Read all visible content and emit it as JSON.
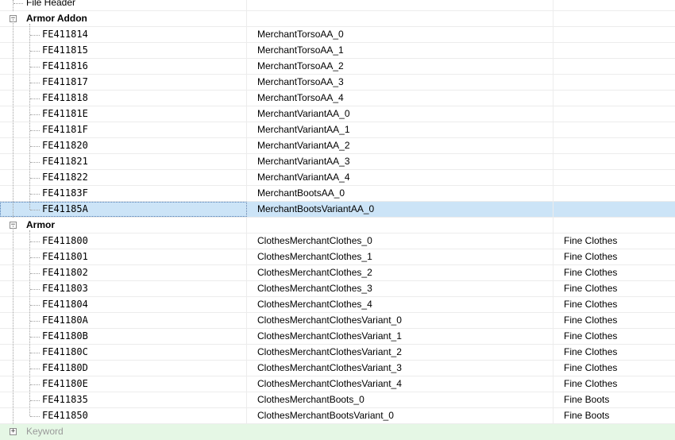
{
  "top": {
    "label": "File Header"
  },
  "groups": [
    {
      "label": "Armor Addon",
      "rows": [
        {
          "formid": "FE411814",
          "edid": "MerchantTorsoAA_0",
          "name": ""
        },
        {
          "formid": "FE411815",
          "edid": "MerchantTorsoAA_1",
          "name": ""
        },
        {
          "formid": "FE411816",
          "edid": "MerchantTorsoAA_2",
          "name": ""
        },
        {
          "formid": "FE411817",
          "edid": "MerchantTorsoAA_3",
          "name": ""
        },
        {
          "formid": "FE411818",
          "edid": "MerchantTorsoAA_4",
          "name": ""
        },
        {
          "formid": "FE41181E",
          "edid": "MerchantVariantAA_0",
          "name": ""
        },
        {
          "formid": "FE41181F",
          "edid": "MerchantVariantAA_1",
          "name": ""
        },
        {
          "formid": "FE411820",
          "edid": "MerchantVariantAA_2",
          "name": ""
        },
        {
          "formid": "FE411821",
          "edid": "MerchantVariantAA_3",
          "name": ""
        },
        {
          "formid": "FE411822",
          "edid": "MerchantVariantAA_4",
          "name": ""
        },
        {
          "formid": "FE41183F",
          "edid": "MerchantBootsAA_0",
          "name": ""
        },
        {
          "formid": "FE41185A",
          "edid": "MerchantBootsVariantAA_0",
          "name": "",
          "selected": true
        }
      ]
    },
    {
      "label": "Armor",
      "rows": [
        {
          "formid": "FE411800",
          "edid": "ClothesMerchantClothes_0",
          "name": "Fine Clothes"
        },
        {
          "formid": "FE411801",
          "edid": "ClothesMerchantClothes_1",
          "name": "Fine Clothes"
        },
        {
          "formid": "FE411802",
          "edid": "ClothesMerchantClothes_2",
          "name": "Fine Clothes"
        },
        {
          "formid": "FE411803",
          "edid": "ClothesMerchantClothes_3",
          "name": "Fine Clothes"
        },
        {
          "formid": "FE411804",
          "edid": "ClothesMerchantClothes_4",
          "name": "Fine Clothes"
        },
        {
          "formid": "FE41180A",
          "edid": "ClothesMerchantClothesVariant_0",
          "name": "Fine Clothes"
        },
        {
          "formid": "FE41180B",
          "edid": "ClothesMerchantClothesVariant_1",
          "name": "Fine Clothes"
        },
        {
          "formid": "FE41180C",
          "edid": "ClothesMerchantClothesVariant_2",
          "name": "Fine Clothes"
        },
        {
          "formid": "FE41180D",
          "edid": "ClothesMerchantClothesVariant_3",
          "name": "Fine Clothes"
        },
        {
          "formid": "FE41180E",
          "edid": "ClothesMerchantClothesVariant_4",
          "name": "Fine Clothes"
        },
        {
          "formid": "FE411835",
          "edid": "ClothesMerchantBoots_0",
          "name": "Fine Boots"
        },
        {
          "formid": "FE411850",
          "edid": "ClothesMerchantBootsVariant_0",
          "name": "Fine Boots"
        }
      ]
    }
  ],
  "bottom": {
    "label": "Keyword"
  },
  "colors": {
    "selection": "#cce4f7",
    "bottom_row": "#e5f7e5"
  }
}
